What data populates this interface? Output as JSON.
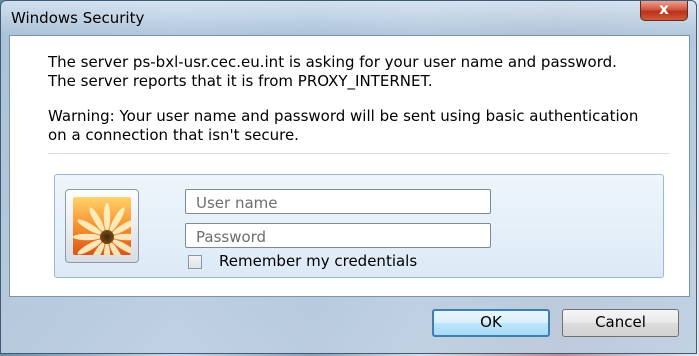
{
  "window": {
    "title": "Windows Security",
    "close_label": "x"
  },
  "message": {
    "line1": "The server ps-bxl-usr.cec.eu.int is asking for your user name and password. The server reports that it is from PROXY_INTERNET.",
    "warning": "Warning: Your user name and password will be sent using basic authentication on a connection that isn't secure."
  },
  "credentials": {
    "username_placeholder": "User name",
    "username_value": "",
    "password_placeholder": "Password",
    "password_value": "",
    "remember_label": "Remember my credentials",
    "remember_checked": false
  },
  "buttons": {
    "ok": "OK",
    "cancel": "Cancel"
  },
  "icons": {
    "user_tile": "flower-user-picture-icon",
    "close": "close-icon",
    "checkbox": "checkbox-unchecked"
  },
  "colors": {
    "titlebar": "#b0c6dc",
    "close_button": "#c8452b",
    "panel_bg": "#dceaf6",
    "ok_border": "#3c7fb1"
  }
}
